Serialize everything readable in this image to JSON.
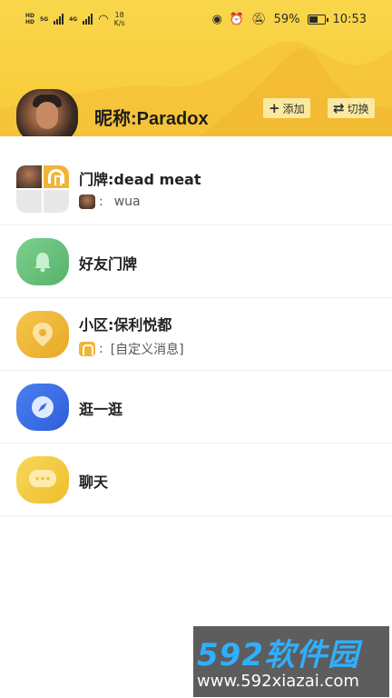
{
  "status_bar": {
    "network_speed_value": "18",
    "network_speed_unit": "K/s",
    "battery": "59%",
    "time": "10:53",
    "net_labels": [
      "HD",
      "HD"
    ],
    "gen_labels": [
      "5G",
      "4G"
    ]
  },
  "header": {
    "nickname": "昵称:Paradox",
    "add_label": "添加",
    "switch_label": "切换",
    "background_color": "#f8cf3f"
  },
  "list": {
    "items": [
      {
        "title": "门牌:dead meat",
        "subtitle": "wua",
        "subtitle_prefix": ":"
      },
      {
        "title": "好友门牌"
      },
      {
        "title": "小区:保利悦都",
        "subtitle": "[自定义消息]",
        "subtitle_prefix": ":"
      },
      {
        "title": "逛一逛"
      },
      {
        "title": "聊天"
      }
    ]
  },
  "icons": {
    "bell": "bell-icon",
    "location": "map-pin-icon",
    "compass": "compass-icon",
    "chat": "chat-bubble-icon"
  },
  "watermark": {
    "big_text": "592软件园",
    "url": "www.592xiazai.com"
  }
}
